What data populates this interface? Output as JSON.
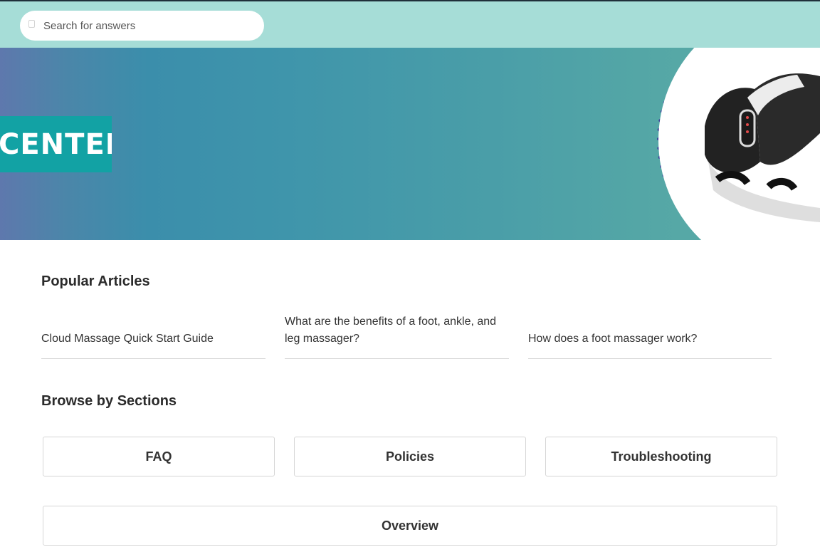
{
  "search": {
    "placeholder": "Search for answers"
  },
  "hero": {
    "title_fragment": "CENTER"
  },
  "popular": {
    "heading": "Popular Articles",
    "articles": [
      "Cloud Massage Quick Start Guide",
      "What are the benefits of a foot, ankle, and leg massager?",
      "How does a foot massager work?"
    ]
  },
  "sections": {
    "heading": "Browse by Sections",
    "items": [
      "FAQ",
      "Policies",
      "Troubleshooting",
      "Overview"
    ]
  },
  "colors": {
    "topbar": "#a6ddd7",
    "badge": "#12a2a4",
    "dots": "#3b3f9a"
  }
}
